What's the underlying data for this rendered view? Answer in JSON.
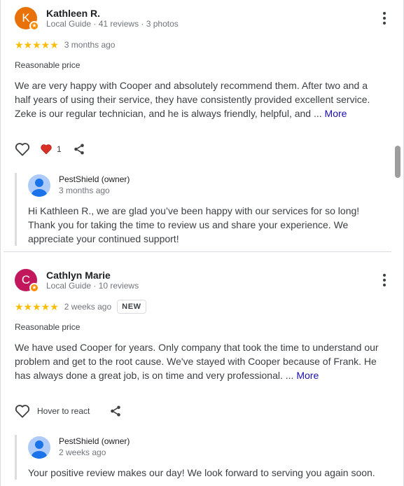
{
  "reviews": [
    {
      "avatar_letter": "K",
      "avatar_color": "#e8710a",
      "name": "Kathleen R.",
      "meta": "Local Guide · 41 reviews · 3 photos",
      "stars": "★★★★★",
      "rating": 5,
      "date": "3 months ago",
      "new_badge": "",
      "tag": "Reasonable price",
      "text": "We are very happy with Cooper and absolutely recommend them. After two and a half years of using their service, they have consistently provided excellent service. Zeke is our regular technician, and he is always friendly, helpful, and ...",
      "more": "More",
      "reaction_count": "1",
      "reply": {
        "owner": "PestShield (owner)",
        "date": "3 months ago",
        "text": "Hi Kathleen R., we are glad you’ve been happy with our services for so long! Thank you for taking the time to review us and share your experience. We appreciate your continued support!"
      }
    },
    {
      "avatar_letter": "C",
      "avatar_color": "#c2185b",
      "name": "Cathlyn Marie",
      "meta": "Local Guide · 10 reviews",
      "stars": "★★★★★",
      "rating": 5,
      "date": "2 weeks ago",
      "new_badge": "NEW",
      "tag": "Reasonable price",
      "text": "We have used Cooper for years. Only company that took the time to understand our problem and get to the root cause. We've stayed with Cooper because of Frank. He has always done a great job, is on time and very professional. ...",
      "more": "More",
      "hover_label": "Hover to react",
      "reply": {
        "owner": "PestShield (owner)",
        "date": "2 weeks ago",
        "text": "Your positive review makes our day! We look forward to serving you again soon."
      }
    }
  ],
  "colors": {
    "star": "#fbbc04",
    "heart": "#d93025",
    "link": "#1a0dab"
  }
}
